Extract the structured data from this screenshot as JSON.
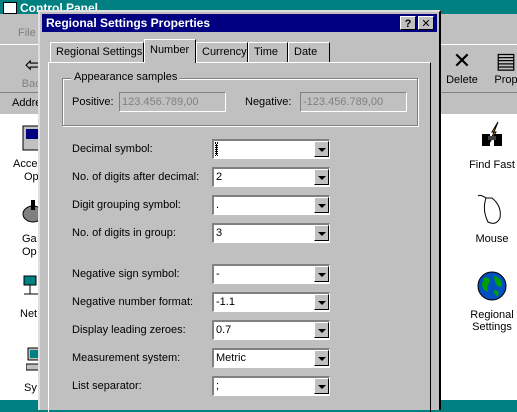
{
  "control_panel": {
    "title": "Control Panel",
    "menu_file": "File",
    "toolbar": {
      "back_label": "Back",
      "delete_label": "Delete",
      "properties_label": "Prop"
    },
    "address_label": "Address",
    "right_items": [
      {
        "label_1": "Find Fast",
        "label_2": "",
        "icon": "binoculars-icon"
      },
      {
        "label_1": "Mouse",
        "label_2": "",
        "icon": "mouse-icon"
      },
      {
        "label_1": "Regional",
        "label_2": "Settings",
        "icon": "globe-icon"
      }
    ],
    "left_fragments": [
      {
        "line1": "Acce",
        "line2": "Op"
      },
      {
        "line1": "Ga",
        "line2": "Op"
      },
      {
        "line1": "Net",
        "line2": ""
      },
      {
        "line1": "Sy",
        "line2": ""
      }
    ]
  },
  "dialog": {
    "title": "Regional Settings Properties",
    "help_button": "?",
    "close_button": "✕",
    "tabs": [
      {
        "label": "Regional Settings",
        "active": false
      },
      {
        "label": "Number",
        "active": true
      },
      {
        "label": "Currency",
        "active": false
      },
      {
        "label": "Time",
        "active": false
      },
      {
        "label": "Date",
        "active": false
      }
    ],
    "appearance": {
      "legend": "Appearance samples",
      "positive_label": "Positive:",
      "positive_value": "123.456.789,00",
      "negative_label": "Negative:",
      "negative_value": "-123.456.789,00"
    },
    "settings": [
      {
        "label": "Decimal symbol:",
        "value": ""
      },
      {
        "label": "No. of digits after decimal:",
        "value": "2"
      },
      {
        "label": "Digit grouping symbol:",
        "value": "."
      },
      {
        "label": "No. of digits in group:",
        "value": "3"
      },
      {
        "label": "Negative sign symbol:",
        "value": "-"
      },
      {
        "label": "Negative number format:",
        "value": "-1.1"
      },
      {
        "label": "Display leading zeroes:",
        "value": "0.7"
      },
      {
        "label": "Measurement system:",
        "value": "Metric"
      },
      {
        "label": "List separator:",
        "value": ";"
      }
    ]
  }
}
